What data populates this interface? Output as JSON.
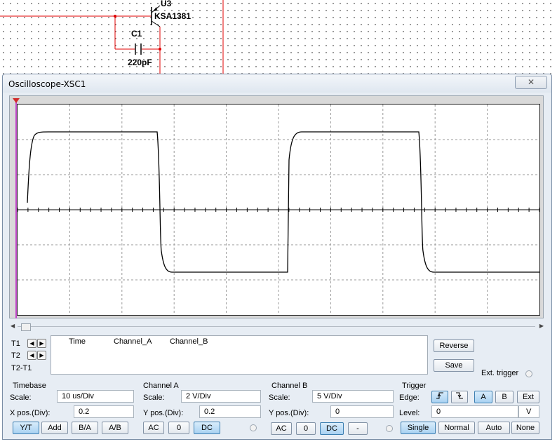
{
  "schematic": {
    "transistor_ref": "U3",
    "transistor_part": "KSA1381",
    "cap_ref": "C1",
    "cap_value": "220pF",
    "wire_color": "#e00000"
  },
  "window": {
    "title": "Oscilloscope-XSC1",
    "close_icon": "close-icon"
  },
  "scope": {
    "trace_color": "#000000",
    "grid_color": "#9a9a9a",
    "cursor_color": "#c048c8"
  },
  "cursors": {
    "t1": "T1",
    "t2": "T2",
    "t2t1": "T2-T1"
  },
  "readout": {
    "headers": [
      "Time",
      "Channel_A",
      "Channel_B"
    ]
  },
  "side": {
    "reverse": "Reverse",
    "save": "Save",
    "ext_trigger": "Ext. trigger"
  },
  "timebase": {
    "title": "Timebase",
    "scale_label": "Scale:",
    "scale_value": "10 us/Div",
    "xpos_label": "X pos.(Div):",
    "xpos_value": "0.2",
    "buttons": [
      "Y/T",
      "Add",
      "B/A",
      "A/B"
    ],
    "active": "Y/T"
  },
  "channel_a": {
    "title": "Channel A",
    "scale_label": "Scale:",
    "scale_value": "2  V/Div",
    "ypos_label": "Y pos.(Div):",
    "ypos_value": "0.2",
    "buttons": [
      "AC",
      "0",
      "DC"
    ],
    "active": "DC"
  },
  "channel_b": {
    "title": "Channel B",
    "scale_label": "Scale:",
    "scale_value": "5  V/Div",
    "ypos_label": "Y pos.(Div):",
    "ypos_value": "0",
    "buttons": [
      "AC",
      "0",
      "DC",
      "-"
    ],
    "active": "DC"
  },
  "trigger": {
    "title": "Trigger",
    "edge_label": "Edge:",
    "level_label": "Level:",
    "level_value": "0",
    "level_unit": "V",
    "edge_buttons": [
      "rising-edge-icon",
      "falling-edge-icon"
    ],
    "source_buttons": [
      "A",
      "B",
      "Ext"
    ],
    "mode_buttons": [
      "Single",
      "Normal",
      "Auto",
      "None"
    ],
    "active_edge": "rising-edge-icon",
    "active_source": "A",
    "active_mode": "Single"
  }
}
